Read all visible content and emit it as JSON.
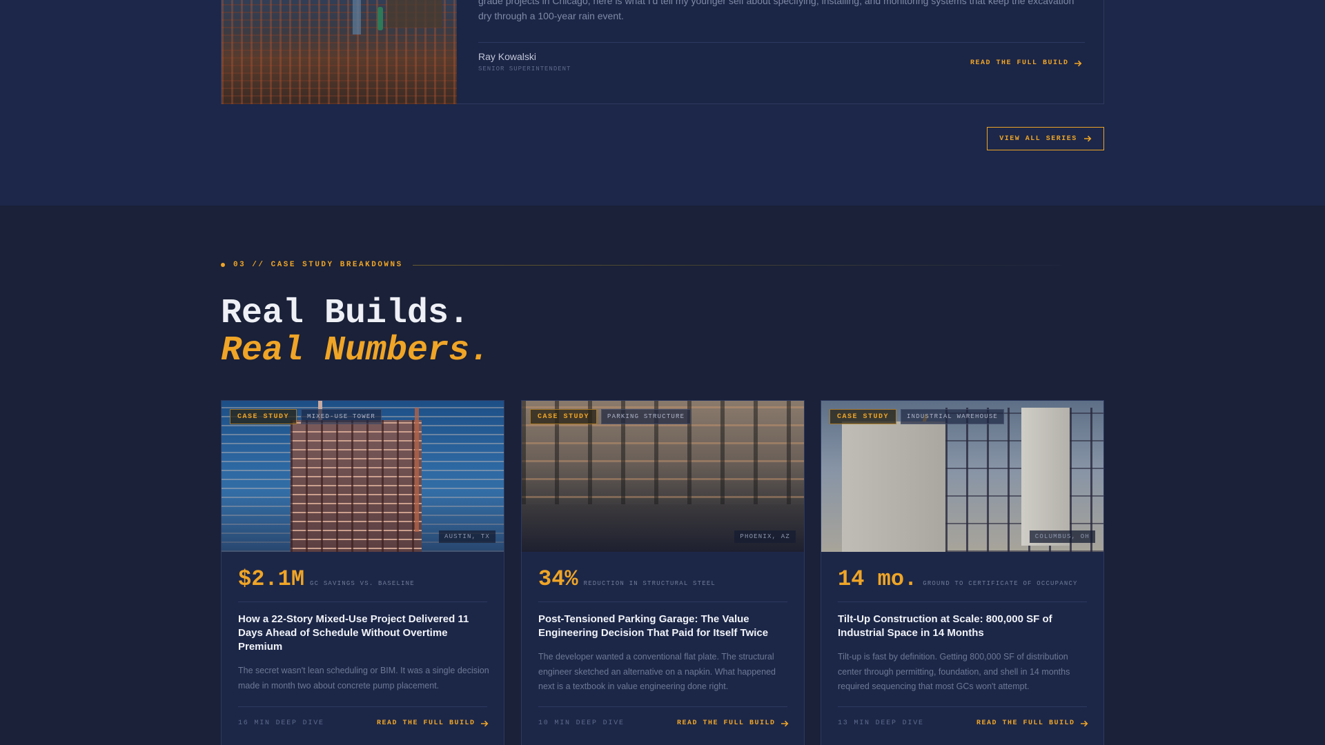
{
  "featured": {
    "excerpt": "grade projects in Chicago, here is what I'd tell my younger self about specifying, installing, and monitoring systems that keep the excavation dry through a 100-year rain event.",
    "author_name": "Ray Kowalski",
    "author_role": "SENIOR SUPERINTENDENT",
    "read_link": "READ THE FULL BUILD"
  },
  "view_all_label": "VIEW ALL SERIES",
  "section": {
    "eyebrow": "03 // CASE STUDY BREAKDOWNS",
    "headline_line1": "Real Builds.",
    "headline_line2": "Real Numbers."
  },
  "cards": [
    {
      "tag": "CASE STUDY",
      "type": "MIXED-USE TOWER",
      "location": "AUSTIN, TX",
      "stat_value": "$2.1M",
      "stat_label": "GC SAVINGS VS. BASELINE",
      "title": "How a 22-Story Mixed-Use Project Delivered 11 Days Ahead of Schedule Without Overtime Premium",
      "excerpt": "The secret wasn't lean scheduling or BIM. It was a single decision made in month two about concrete pump placement.",
      "read_time": "16 MIN DEEP DIVE",
      "read_link": "READ THE FULL BUILD"
    },
    {
      "tag": "CASE STUDY",
      "type": "PARKING STRUCTURE",
      "location": "PHOENIX, AZ",
      "stat_value": "34%",
      "stat_label": "REDUCTION IN STRUCTURAL STEEL",
      "title": "Post-Tensioned Parking Garage: The Value Engineering Decision That Paid for Itself Twice",
      "excerpt": "The developer wanted a conventional flat plate. The structural engineer sketched an alternative on a napkin. What happened next is a textbook in value engineering done right.",
      "read_time": "10 MIN DEEP DIVE",
      "read_link": "READ THE FULL BUILD"
    },
    {
      "tag": "CASE STUDY",
      "type": "INDUSTRIAL WAREHOUSE",
      "location": "COLUMBUS, OH",
      "stat_value": "14 mo.",
      "stat_label": "GROUND TO CERTIFICATE OF OCCUPANCY",
      "title": "Tilt-Up Construction at Scale: 800,000 SF of Industrial Space in 14 Months",
      "excerpt": "Tilt-up is fast by definition. Getting 800,000 SF of distribution center through permitting, foundation, and shell in 14 months required sequencing that most GCs won't attempt.",
      "read_time": "13 MIN DEEP DIVE",
      "read_link": "READ THE FULL BUILD"
    }
  ],
  "colors": {
    "accent": "#f0a526",
    "band": "#1c2749",
    "page": "#1a2138"
  }
}
